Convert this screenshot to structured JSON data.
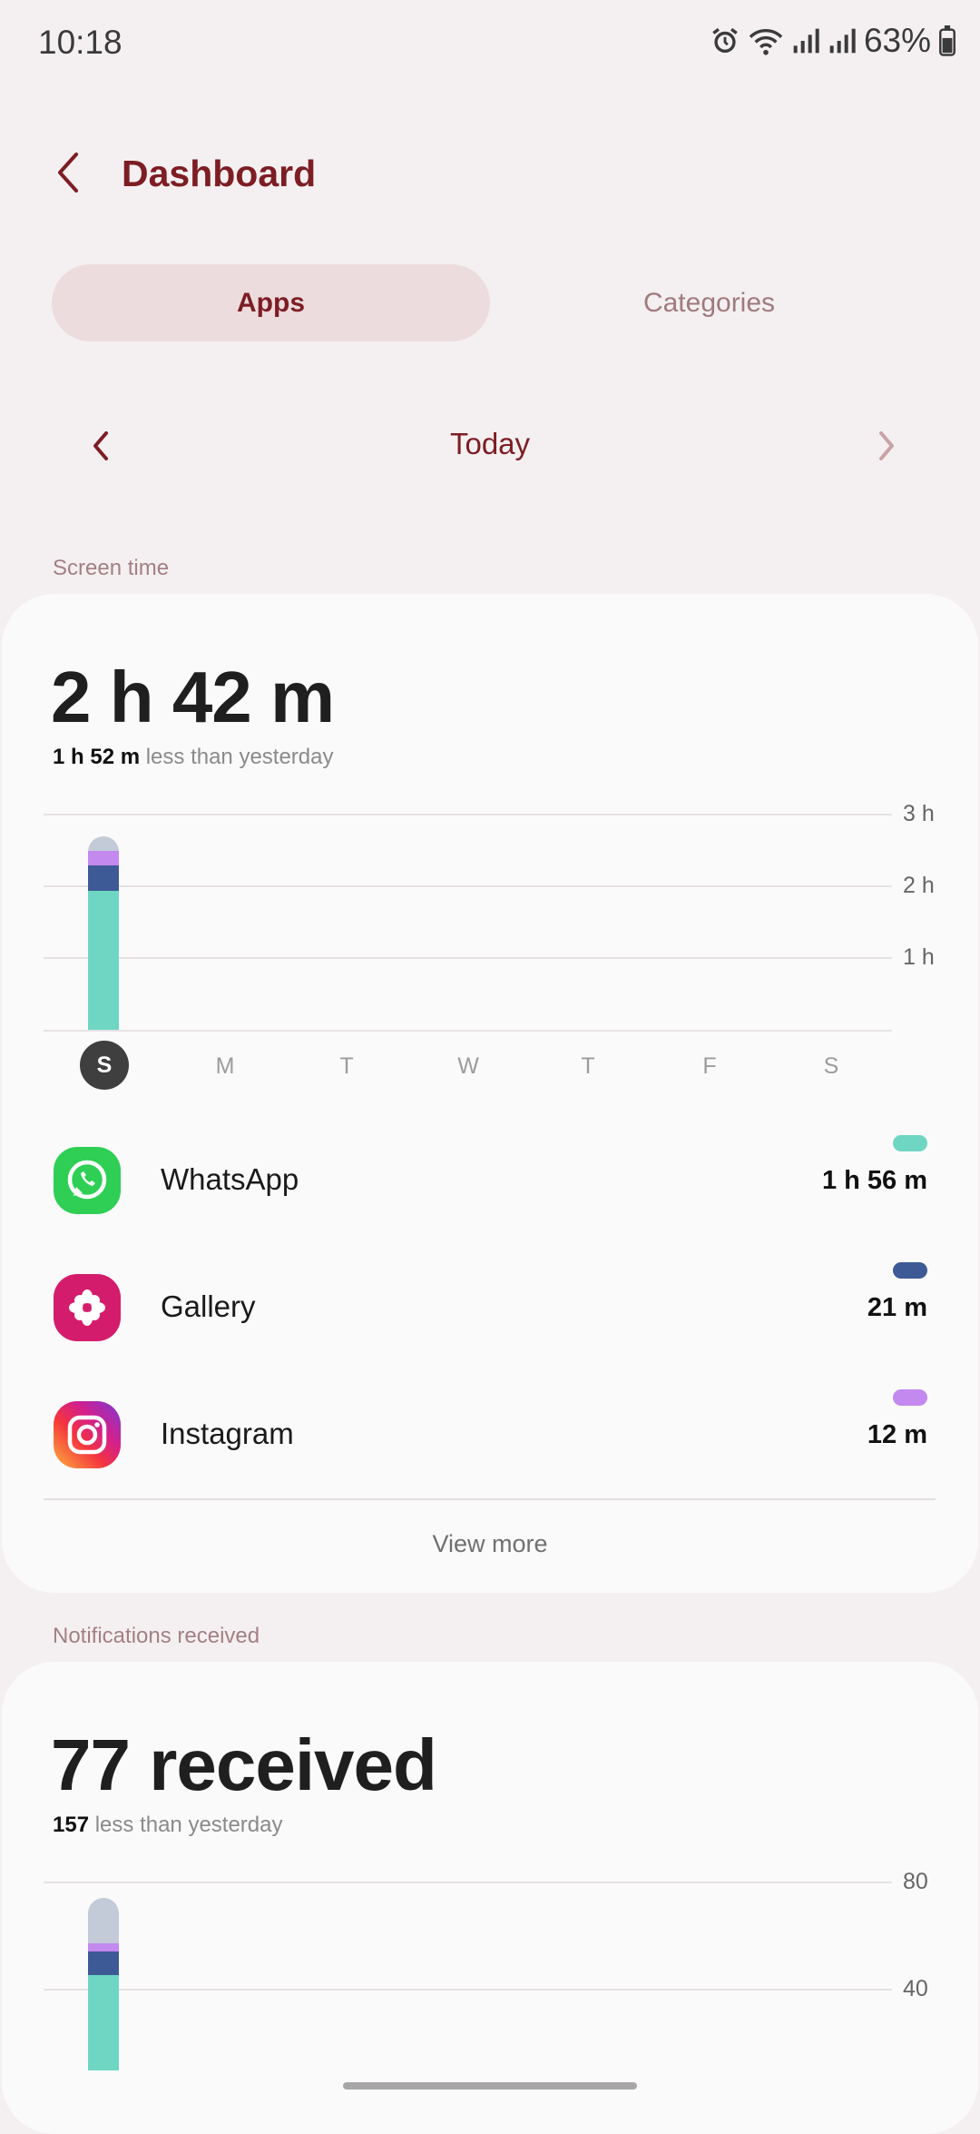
{
  "status": {
    "time": "10:18",
    "battery": "63%"
  },
  "header": {
    "title": "Dashboard"
  },
  "tabs": [
    {
      "label": "Apps",
      "selected": true
    },
    {
      "label": "Categories",
      "selected": false
    }
  ],
  "date_nav": {
    "label": "Today"
  },
  "screen_time": {
    "section_label": "Screen time",
    "total": "2 h 42 m",
    "compare_value": "1 h 52 m",
    "compare_text": " less than yesterday",
    "y_ticks": [
      "3 h",
      "2 h",
      "1 h"
    ],
    "days": [
      "S",
      "M",
      "T",
      "W",
      "T",
      "F",
      "S"
    ],
    "selected_day_index": 0,
    "apps": [
      {
        "name": "WhatsApp",
        "time": "1 h 56 m",
        "color": "#6ed6c3",
        "icon": "whatsapp-icon"
      },
      {
        "name": "Gallery",
        "time": "21 m",
        "color": "#3e5a96",
        "icon": "gallery-icon"
      },
      {
        "name": "Instagram",
        "time": "12 m",
        "color": "#c389ef",
        "icon": "instagram-icon"
      }
    ],
    "view_more": "View more"
  },
  "notifications": {
    "section_label": "Notifications received",
    "total": "77 received",
    "compare_value": "157",
    "compare_text": " less than yesterday",
    "y_ticks": [
      "80",
      "40"
    ]
  },
  "chart_data": [
    {
      "type": "bar",
      "categories": [
        "S",
        "M",
        "T",
        "W",
        "T",
        "F",
        "S"
      ],
      "ylim": [
        0,
        3
      ],
      "ylabel": "",
      "series": [
        {
          "name": "WhatsApp",
          "values": [
            1.93,
            0,
            0,
            0,
            0,
            0,
            0
          ]
        },
        {
          "name": "Gallery",
          "values": [
            0.35,
            0,
            0,
            0,
            0,
            0,
            0
          ]
        },
        {
          "name": "Instagram",
          "values": [
            0.2,
            0,
            0,
            0,
            0,
            0,
            0
          ]
        },
        {
          "values": [
            0.2,
            0,
            0,
            0,
            0,
            0,
            0
          ]
        }
      ],
      "colors": [
        "#6ed6c3",
        "#3e5a96",
        "#c389ef",
        "#c3cad8"
      ]
    },
    {
      "type": "bar",
      "categories": [
        "S"
      ],
      "ylim": [
        0,
        80
      ],
      "series": [
        {
          "values": [
            45
          ]
        },
        {
          "values": [
            9
          ]
        },
        {
          "values": [
            3
          ]
        },
        {
          "values": [
            17
          ]
        }
      ],
      "colors": [
        "#6ed6c3",
        "#3e5a96",
        "#c389ef",
        "#c3cad8"
      ]
    }
  ]
}
